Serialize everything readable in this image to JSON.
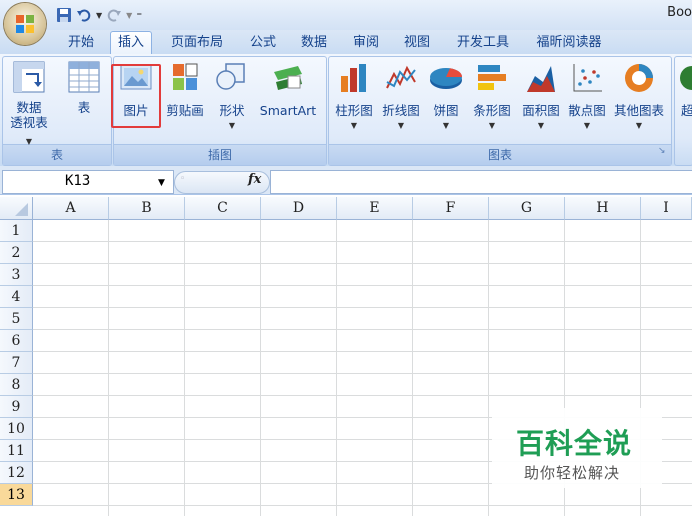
{
  "window": {
    "title": "Boo"
  },
  "tabs": [
    "开始",
    "插入",
    "页面布局",
    "公式",
    "数据",
    "审阅",
    "视图",
    "开发工具",
    "福昕阅读器"
  ],
  "ribbon": {
    "groups": {
      "table": "表",
      "illustrations": "插图",
      "charts": "图表"
    },
    "table_buttons": [
      {
        "label_l1": "数据",
        "label_l2": "透视表"
      },
      {
        "label": "表"
      }
    ],
    "illustration_buttons": [
      "图片",
      "剪贴画",
      "形状",
      "SmartArt"
    ],
    "chart_buttons": [
      "柱形图",
      "折线图",
      "饼图",
      "条形图",
      "面积图",
      "散点图",
      "其他图表"
    ],
    "overflow_label": "超"
  },
  "formula_bar": {
    "name_box": "K13",
    "fx": "fx",
    "value": ""
  },
  "sheet": {
    "columns": [
      "A",
      "B",
      "C",
      "D",
      "E",
      "F",
      "G",
      "H",
      "I"
    ],
    "rows": [
      "1",
      "2",
      "3",
      "4",
      "5",
      "6",
      "7",
      "8",
      "9",
      "10",
      "11",
      "12",
      "13"
    ],
    "selected_row": "13"
  },
  "watermark": {
    "title": "百科全说",
    "subtitle": "助你轻松解决"
  },
  "colors": {
    "accent": "#15428b",
    "highlight": "#e23b3b",
    "watermark": "#1f9e55"
  }
}
